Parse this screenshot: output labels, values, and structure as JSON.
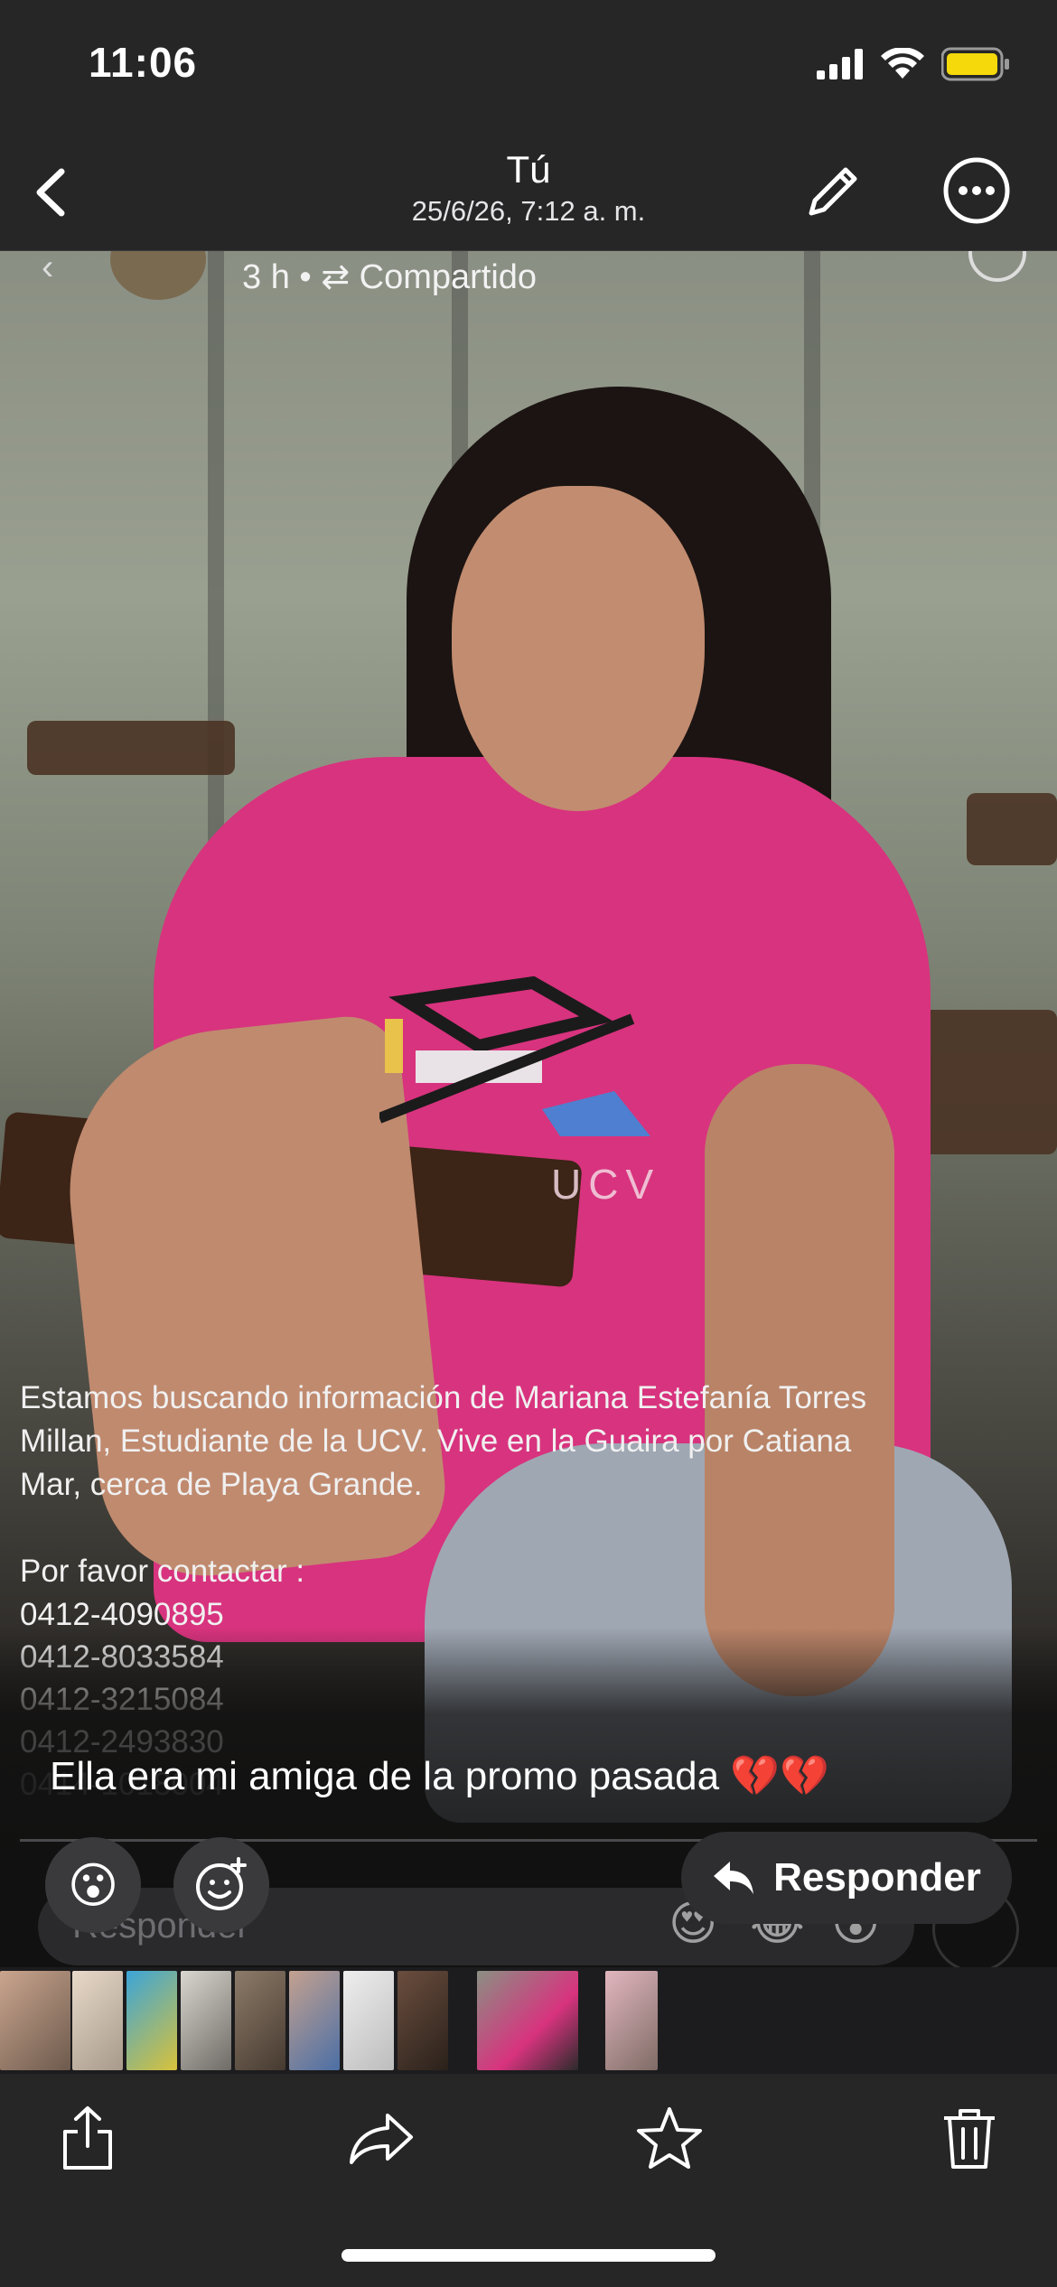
{
  "status_bar": {
    "time": "11:06"
  },
  "nav": {
    "title": "Tú",
    "subtitle": "25/6/26, 7:12 a. m."
  },
  "post": {
    "meta": "3 h • ⇄ Compartido",
    "logo_text": "UCV",
    "overlay_lines": [
      "Estamos buscando información de Mariana Estefanía Torres",
      "Millan, Estudiante de la UCV. Vive en la Guaira por Catiana",
      "Mar, cerca de Playa Grande."
    ],
    "contact_label": "Por favor contactar :",
    "phones": [
      "0412-4090895",
      "0412-8033584",
      "0412-3215084",
      "0412-2493830",
      "0414-1018004"
    ]
  },
  "message": {
    "caption": "Ella era mi amiga de la promo pasada 💔💔",
    "reply_placeholder": "Responder",
    "reply_button": "Responder",
    "reaction_emoji": "😮",
    "faded_emojis": [
      "😍",
      "😂",
      "😮"
    ]
  },
  "colors": {
    "bar_bg": "#262627",
    "shirt": "#d8337e",
    "battery": "#f5d90a"
  },
  "toolbar": {
    "icons": [
      "share-icon",
      "forward-icon",
      "star-icon",
      "trash-icon"
    ]
  }
}
